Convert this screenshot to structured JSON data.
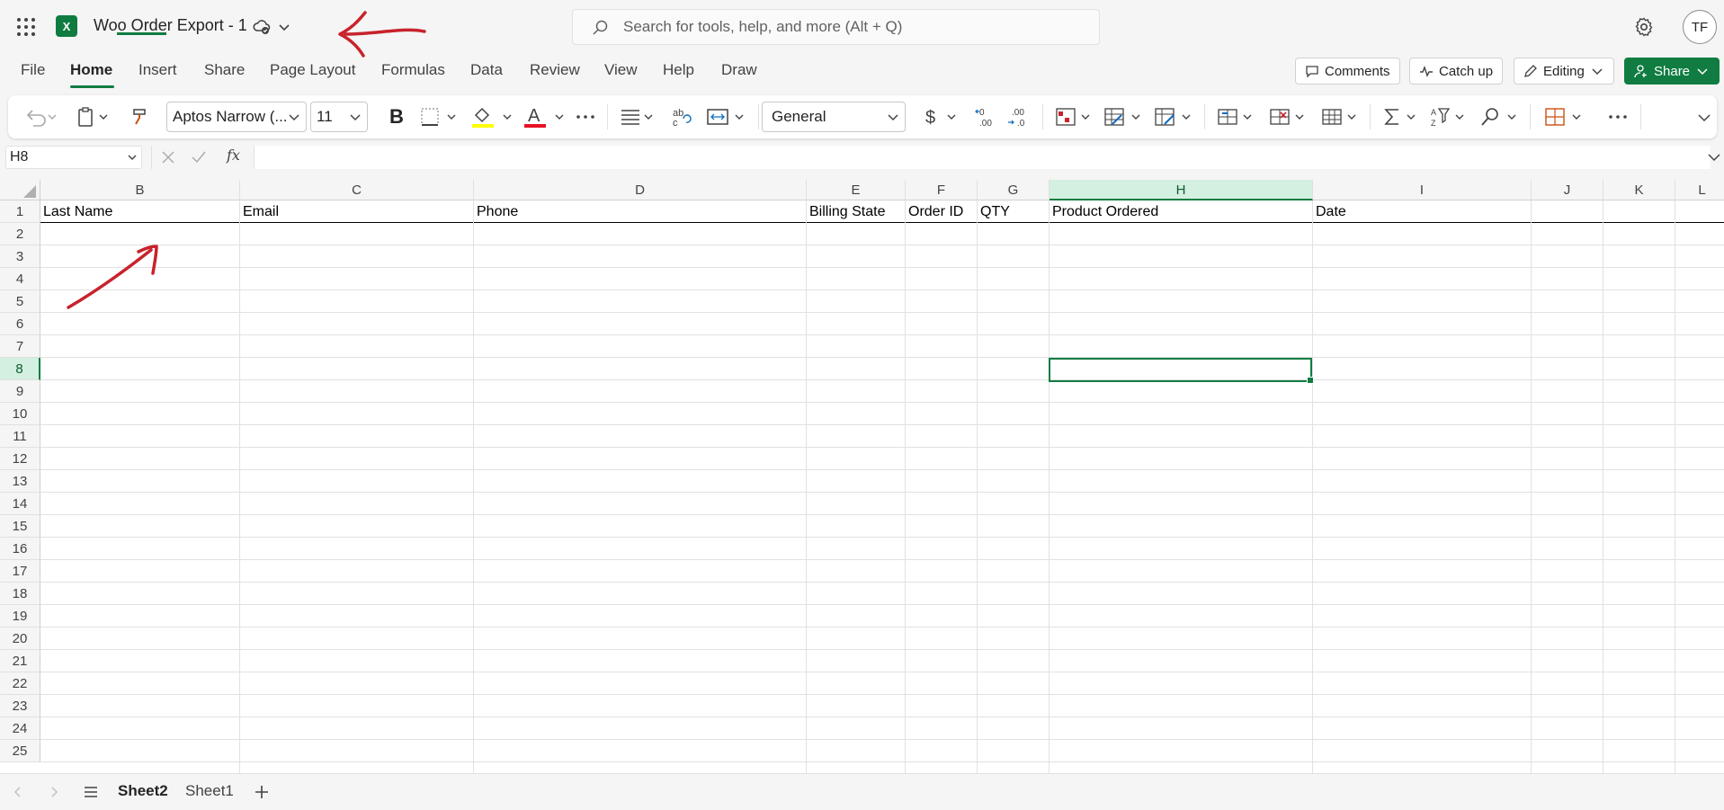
{
  "app": {
    "document_title": "Woo Order Export - 1",
    "logo_letter": "X",
    "user_initials": "TF"
  },
  "search": {
    "placeholder": "Search for tools, help, and more (Alt + Q)"
  },
  "menu": {
    "tabs": [
      "File",
      "Home",
      "Insert",
      "Share",
      "Page Layout",
      "Formulas",
      "Data",
      "Review",
      "View",
      "Help",
      "Draw"
    ],
    "active_tab": "Home",
    "comments_label": "Comments",
    "catchup_label": "Catch up",
    "editing_label": "Editing",
    "share_label": "Share"
  },
  "ribbon": {
    "font_name": "Aptos Narrow (...",
    "font_size": "11",
    "number_format": "General",
    "bold_glyph": "B",
    "font_color_glyph": "A"
  },
  "formula_bar": {
    "name_box": "H8",
    "fx_label": "fx",
    "formula": ""
  },
  "grid": {
    "columns": [
      "B",
      "C",
      "D",
      "E",
      "F",
      "G",
      "H",
      "I",
      "J",
      "K",
      "L"
    ],
    "selected_column": "H",
    "rows": [
      "1",
      "2",
      "3",
      "4",
      "5",
      "6",
      "7",
      "8",
      "9",
      "10",
      "11",
      "12",
      "13",
      "14",
      "15",
      "16",
      "17",
      "18",
      "19",
      "20",
      "21",
      "22",
      "23",
      "24",
      "25"
    ],
    "selected_row": "8",
    "headers": [
      "Last Name",
      "Email",
      "Phone",
      "Billing State",
      "Order ID",
      "QTY",
      "Product Ordered",
      "Date"
    ],
    "selected_cell": "H8"
  },
  "sheets": {
    "tabs": [
      "Sheet2",
      "Sheet1"
    ],
    "active": "Sheet2"
  },
  "colors": {
    "accent": "#107c41",
    "annotation": "#c8232c"
  }
}
